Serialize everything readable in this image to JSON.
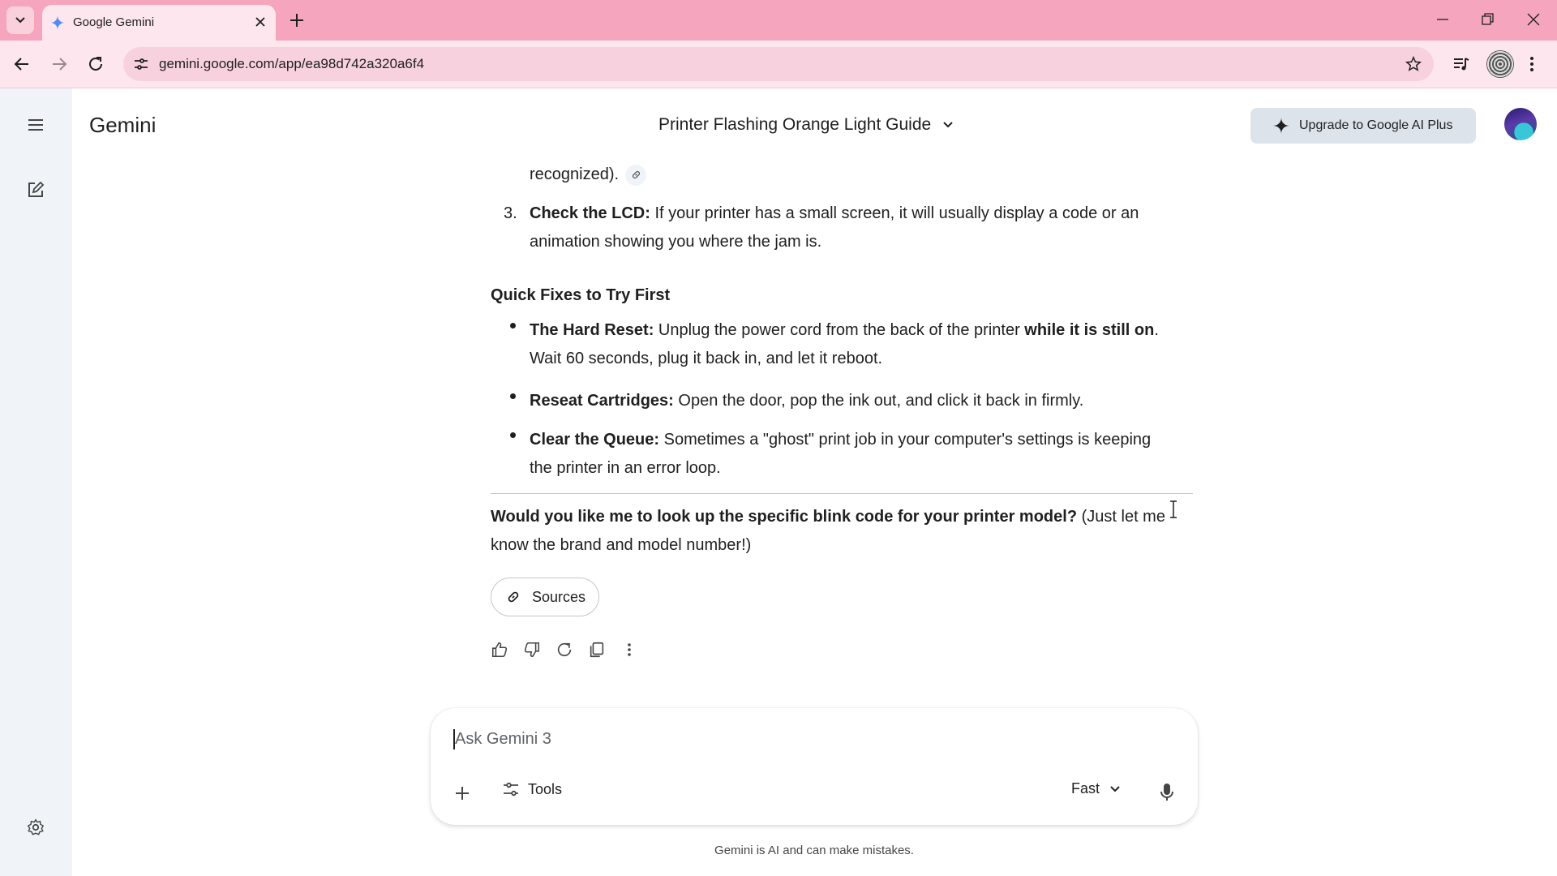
{
  "browser": {
    "tab_title": "Google Gemini",
    "url": "gemini.google.com/app/ea98d742a320a6f4"
  },
  "app": {
    "brand": "Gemini",
    "conversation_title": "Printer Flashing Orange Light Guide",
    "upgrade_label": "Upgrade to Google AI Plus"
  },
  "response": {
    "partial_line": "recognized).",
    "ordered_items": [
      {
        "number": "3.",
        "bold": "Check the LCD:",
        "line1": " If your printer has a small screen, it will usually display a code or an",
        "line2": "animation showing you where the jam is."
      }
    ],
    "section_heading": "Quick Fixes to Try First",
    "bullets": [
      {
        "bold": "The Hard Reset:",
        "text1": " Unplug the power cord from the back of the printer ",
        "bold2": "while it is still on",
        "text1_end": ".",
        "line2": "Wait 60 seconds, plug it back in, and let it reboot."
      },
      {
        "bold": "Reseat Cartridges:",
        "text1": " Open the door, pop the ink out, and click it back in firmly."
      },
      {
        "bold": "Clear the Queue:",
        "text1": " Sometimes a \"ghost\" print job in your computer's settings is keeping",
        "line2": "the printer in an error loop."
      }
    ],
    "question_bold": "Would you like me to look up the specific blink code for your printer model?",
    "question_rest": " (Just let me",
    "question_line2": "know the brand and model number!)",
    "sources_label": "Sources"
  },
  "input": {
    "placeholder": "Ask Gemini 3",
    "tools_label": "Tools",
    "model_label": "Fast"
  },
  "footer": {
    "disclaimer": "Gemini is AI and can make mistakes."
  },
  "icons": [
    "tab-search-icon",
    "gemini-sparkle-icon",
    "close-icon",
    "plus-icon",
    "minimize-icon",
    "restore-icon",
    "back-icon",
    "forward-icon",
    "reload-icon",
    "site-info-icon",
    "star-icon",
    "media-icon",
    "menu-icon",
    "new-chat-icon",
    "settings-icon",
    "link-icon",
    "thumbs-up-icon",
    "thumbs-down-icon",
    "regenerate-icon",
    "copy-icon",
    "more-vert-icon",
    "tools-icon",
    "chevron-down-icon",
    "mic-icon"
  ],
  "colors": {
    "tabstrip": "#f6a5be",
    "toolbar": "#fde6ee",
    "rail": "#f0f4f9",
    "upgrade_bg": "#dde3ea"
  }
}
